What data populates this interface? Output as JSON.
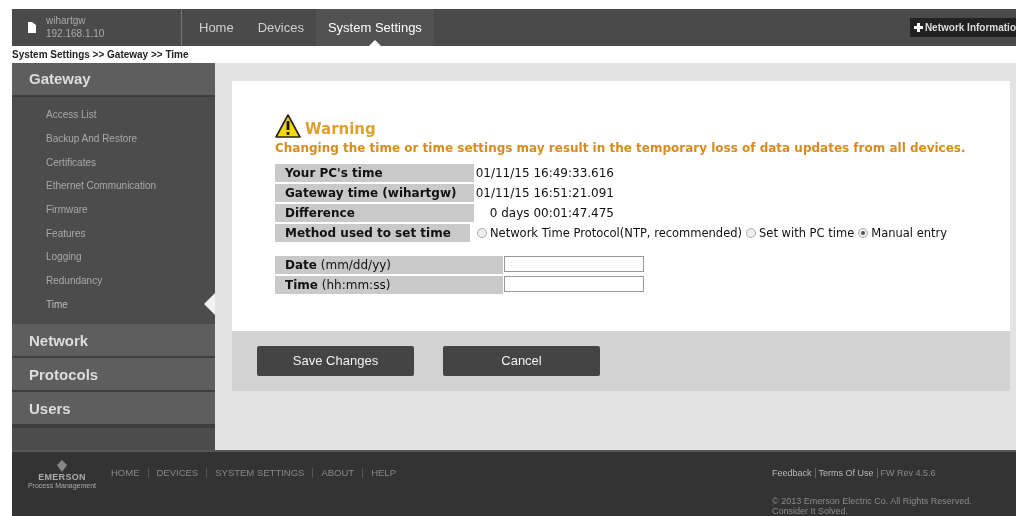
{
  "header": {
    "device_name": "wihartgw",
    "device_ip": "192.168.1.10",
    "nav": [
      {
        "label": "Home",
        "selected": false
      },
      {
        "label": "Devices",
        "selected": false
      },
      {
        "label": "System Settings",
        "selected": true
      }
    ],
    "network_button": "Network Informatio"
  },
  "breadcrumb": "System Settings >> Gateway >> Time",
  "sidebar": {
    "sections": [
      {
        "label": "Gateway",
        "expanded": true,
        "items": [
          {
            "label": "Access List",
            "selected": false
          },
          {
            "label": "Backup And Restore",
            "selected": false
          },
          {
            "label": "Certificates",
            "selected": false
          },
          {
            "label": "Ethernet Communication",
            "selected": false
          },
          {
            "label": "Firmware",
            "selected": false
          },
          {
            "label": "Features",
            "selected": false
          },
          {
            "label": "Logging",
            "selected": false
          },
          {
            "label": "Redundancy",
            "selected": false
          },
          {
            "label": "Time",
            "selected": true
          }
        ]
      },
      {
        "label": "Network",
        "expanded": false
      },
      {
        "label": "Protocols",
        "expanded": false
      },
      {
        "label": "Users",
        "expanded": false
      }
    ]
  },
  "warning": {
    "title": "Warning",
    "message": "Changing the time or time settings may result in the temporary loss of data updates from all devices."
  },
  "time_table": [
    {
      "label": "Your PC's time",
      "value": "01/11/15 16:49:33.616"
    },
    {
      "label": "Gateway time (wihartgw)",
      "value": "01/11/15 16:51:21.091"
    },
    {
      "label": "Difference",
      "value": "0 days 00:01:47.475"
    }
  ],
  "method": {
    "label": "Method used to set time",
    "options": [
      {
        "label": "Network Time Protocol(NTP, recommended)",
        "selected": false
      },
      {
        "label": "Set with PC time",
        "selected": false
      },
      {
        "label": "Manual entry",
        "selected": true
      }
    ]
  },
  "manual_fields": [
    {
      "label": "Date",
      "hint": "(mm/dd/yy)"
    },
    {
      "label": "Time",
      "hint": "(hh:mm:ss)"
    }
  ],
  "buttons": [
    "Save Changes",
    "Cancel"
  ],
  "footer": {
    "brand": "EMERSON",
    "brand_sub": "Process Management",
    "links": [
      "HOME",
      "DEVICES",
      "SYSTEM SETTINGS",
      "ABOUT",
      "HELP"
    ],
    "right_links": [
      "Feedback",
      "Terms Of Use"
    ],
    "firmware": "FW Rev 4.5.6",
    "copyright": "© 2013 Emerson Electric Co. All Rights Reserved.",
    "tagline": "Consider It Solved."
  }
}
